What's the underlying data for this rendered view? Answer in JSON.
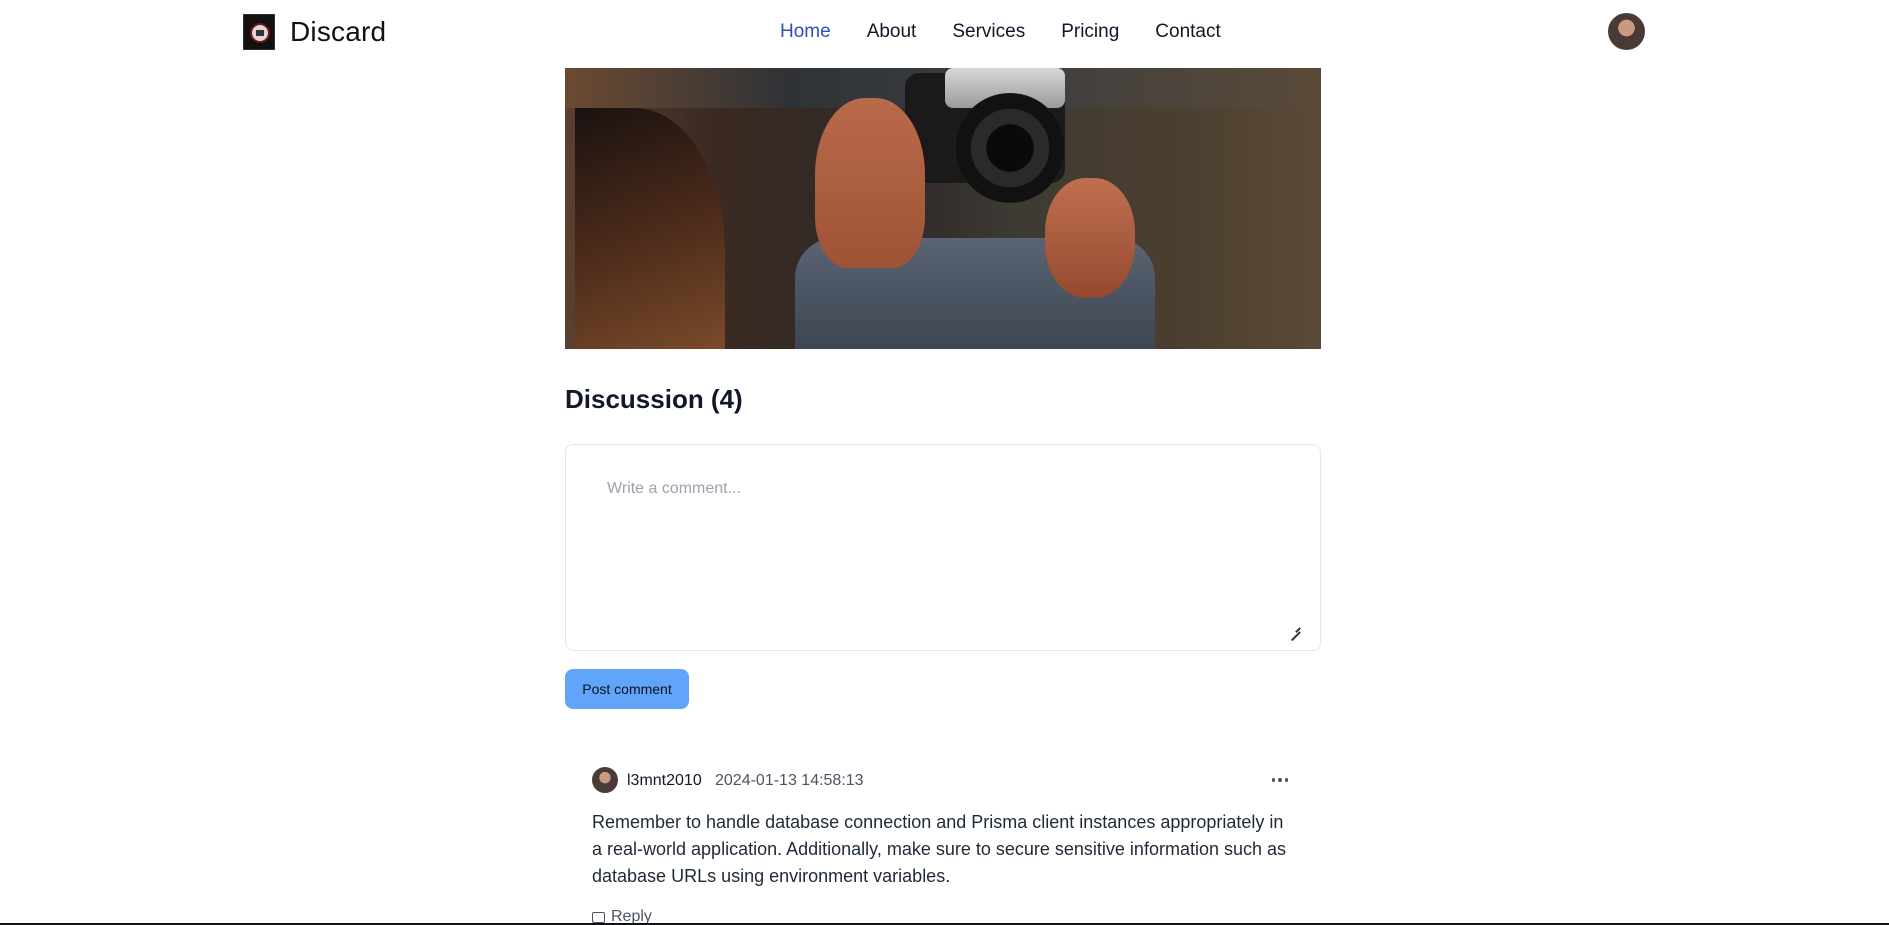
{
  "header": {
    "brand": "Discard",
    "logo_icon": "logo-icon",
    "nav": [
      {
        "label": "Home",
        "active": true
      },
      {
        "label": "About",
        "active": false
      },
      {
        "label": "Services",
        "active": false
      },
      {
        "label": "Pricing",
        "active": false
      },
      {
        "label": "Contact",
        "active": false
      }
    ],
    "active_color": "#2f4fb8"
  },
  "discussion": {
    "title": "Discussion (4)",
    "comment_placeholder": "Write a comment...",
    "post_label": "Post comment",
    "button_color": "#60a5fa"
  },
  "comments": [
    {
      "user": "l3mnt2010",
      "date": "2024-01-13 14:58:13",
      "body": "Remember to handle database connection and Prisma client instances appropriately in a real-world application. Additionally, make sure to secure sensitive information such as database URLs using environment variables.",
      "reply_label": "Reply"
    }
  ]
}
